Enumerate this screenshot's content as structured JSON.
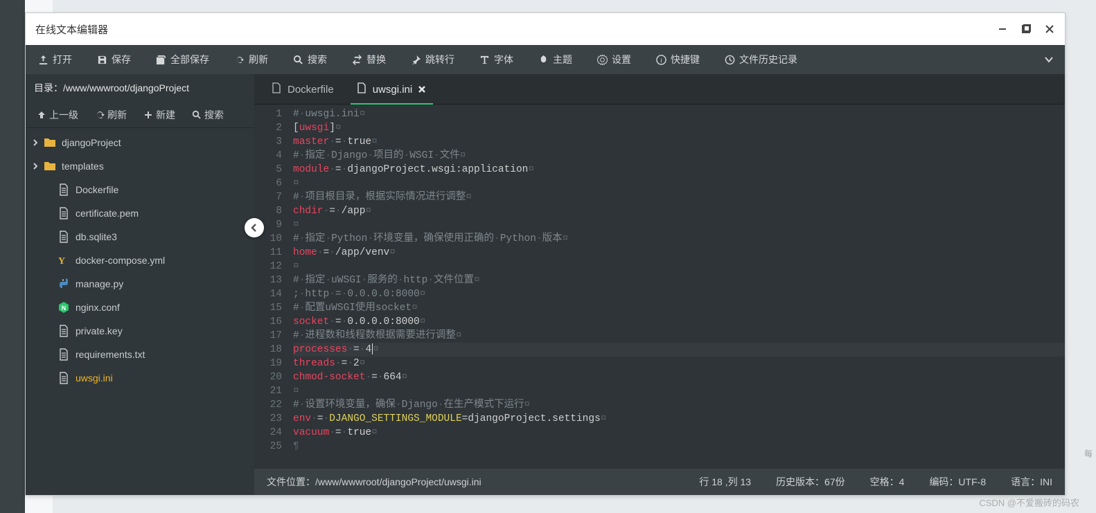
{
  "window_title": "在线文本编辑器",
  "toolbar": {
    "open": "打开",
    "save": "保存",
    "save_all": "全部保存",
    "refresh": "刷新",
    "search": "搜索",
    "replace": "替换",
    "goto": "跳转行",
    "font": "字体",
    "theme": "主题",
    "settings": "设置",
    "shortcut": "快捷键",
    "history": "文件历史记录"
  },
  "sidebar": {
    "path_label": "目录：",
    "path_value": "/www/wwwroot/djangoProject",
    "tools": {
      "up": "上一级",
      "refresh": "刷新",
      "new": "新建",
      "search": "搜索"
    },
    "items": [
      {
        "type": "folder",
        "label": "djangoProject"
      },
      {
        "type": "folder",
        "label": "templates"
      },
      {
        "type": "file",
        "label": "Dockerfile",
        "icon": "file"
      },
      {
        "type": "file",
        "label": "certificate.pem",
        "icon": "file"
      },
      {
        "type": "file",
        "label": "db.sqlite3",
        "icon": "file"
      },
      {
        "type": "file",
        "label": "docker-compose.yml",
        "icon": "yml"
      },
      {
        "type": "file",
        "label": "manage.py",
        "icon": "py"
      },
      {
        "type": "file",
        "label": "nginx.conf",
        "icon": "nginx"
      },
      {
        "type": "file",
        "label": "private.key",
        "icon": "file"
      },
      {
        "type": "file",
        "label": "requirements.txt",
        "icon": "file"
      },
      {
        "type": "file",
        "label": "uwsgi.ini",
        "icon": "file",
        "active": true
      }
    ]
  },
  "tabs": [
    {
      "label": "Dockerfile",
      "active": false
    },
    {
      "label": "uwsgi.ini",
      "active": true,
      "closable": true
    }
  ],
  "code": {
    "lines": [
      [
        {
          "t": "comment",
          "v": "#"
        },
        {
          "t": "invis",
          "v": "·"
        },
        {
          "t": "comment",
          "v": "uwsgi.ini"
        },
        {
          "t": "invis",
          "v": "¤"
        }
      ],
      [
        {
          "t": "punc",
          "v": "["
        },
        {
          "t": "key",
          "v": "uwsgi"
        },
        {
          "t": "punc",
          "v": "]"
        },
        {
          "t": "invis",
          "v": "¤"
        }
      ],
      [
        {
          "t": "key",
          "v": "master"
        },
        {
          "t": "invis",
          "v": "·"
        },
        {
          "t": "punc",
          "v": "="
        },
        {
          "t": "invis",
          "v": "·"
        },
        {
          "t": "const",
          "v": "true"
        },
        {
          "t": "invis",
          "v": "¤"
        }
      ],
      [
        {
          "t": "comment",
          "v": "#"
        },
        {
          "t": "invis",
          "v": "·"
        },
        {
          "t": "comment",
          "v": "指定"
        },
        {
          "t": "invis",
          "v": "·"
        },
        {
          "t": "comment",
          "v": "Django"
        },
        {
          "t": "invis",
          "v": "·"
        },
        {
          "t": "comment",
          "v": "项目的"
        },
        {
          "t": "invis",
          "v": "·"
        },
        {
          "t": "comment",
          "v": "WSGI"
        },
        {
          "t": "invis",
          "v": "·"
        },
        {
          "t": "comment",
          "v": "文件"
        },
        {
          "t": "invis",
          "v": "¤"
        }
      ],
      [
        {
          "t": "key",
          "v": "module"
        },
        {
          "t": "invis",
          "v": "·"
        },
        {
          "t": "punc",
          "v": "="
        },
        {
          "t": "invis",
          "v": "·"
        },
        {
          "t": "const",
          "v": "djangoProject.wsgi:application"
        },
        {
          "t": "invis",
          "v": "¤"
        }
      ],
      [
        {
          "t": "invis",
          "v": "¤"
        }
      ],
      [
        {
          "t": "comment",
          "v": "#"
        },
        {
          "t": "invis",
          "v": "·"
        },
        {
          "t": "comment",
          "v": "项目根目录，根据实际情况进行调整"
        },
        {
          "t": "invis",
          "v": "¤"
        }
      ],
      [
        {
          "t": "key",
          "v": "chdir"
        },
        {
          "t": "invis",
          "v": "·"
        },
        {
          "t": "punc",
          "v": "="
        },
        {
          "t": "invis",
          "v": "·"
        },
        {
          "t": "const",
          "v": "/app"
        },
        {
          "t": "invis",
          "v": "¤"
        }
      ],
      [
        {
          "t": "invis",
          "v": "¤"
        }
      ],
      [
        {
          "t": "comment",
          "v": "#"
        },
        {
          "t": "invis",
          "v": "·"
        },
        {
          "t": "comment",
          "v": "指定"
        },
        {
          "t": "invis",
          "v": "·"
        },
        {
          "t": "comment",
          "v": "Python"
        },
        {
          "t": "invis",
          "v": "·"
        },
        {
          "t": "comment",
          "v": "环境变量，确保使用正确的"
        },
        {
          "t": "invis",
          "v": "·"
        },
        {
          "t": "comment",
          "v": "Python"
        },
        {
          "t": "invis",
          "v": "·"
        },
        {
          "t": "comment",
          "v": "版本"
        },
        {
          "t": "invis",
          "v": "¤"
        }
      ],
      [
        {
          "t": "key",
          "v": "home"
        },
        {
          "t": "invis",
          "v": "·"
        },
        {
          "t": "punc",
          "v": "="
        },
        {
          "t": "invis",
          "v": "·"
        },
        {
          "t": "const",
          "v": "/app/venv"
        },
        {
          "t": "invis",
          "v": "¤"
        }
      ],
      [
        {
          "t": "invis",
          "v": "¤"
        }
      ],
      [
        {
          "t": "comment",
          "v": "#"
        },
        {
          "t": "invis",
          "v": "·"
        },
        {
          "t": "comment",
          "v": "指定"
        },
        {
          "t": "invis",
          "v": "·"
        },
        {
          "t": "comment",
          "v": "uWSGI"
        },
        {
          "t": "invis",
          "v": "·"
        },
        {
          "t": "comment",
          "v": "服务的"
        },
        {
          "t": "invis",
          "v": "·"
        },
        {
          "t": "comment",
          "v": "http"
        },
        {
          "t": "invis",
          "v": "·"
        },
        {
          "t": "comment",
          "v": "文件位置"
        },
        {
          "t": "invis",
          "v": "¤"
        }
      ],
      [
        {
          "t": "comment",
          "v": ";"
        },
        {
          "t": "invis",
          "v": "·"
        },
        {
          "t": "comment",
          "v": "http"
        },
        {
          "t": "invis",
          "v": "·"
        },
        {
          "t": "comment",
          "v": "="
        },
        {
          "t": "invis",
          "v": "·"
        },
        {
          "t": "comment",
          "v": "0.0.0.0:8000"
        },
        {
          "t": "invis",
          "v": "¤"
        }
      ],
      [
        {
          "t": "comment",
          "v": "#"
        },
        {
          "t": "invis",
          "v": "·"
        },
        {
          "t": "comment",
          "v": "配置uWSGI使用socket"
        },
        {
          "t": "invis",
          "v": "¤"
        }
      ],
      [
        {
          "t": "key",
          "v": "socket"
        },
        {
          "t": "invis",
          "v": "·"
        },
        {
          "t": "punc",
          "v": "="
        },
        {
          "t": "invis",
          "v": "·"
        },
        {
          "t": "const",
          "v": "0.0.0.0:8000"
        },
        {
          "t": "invis",
          "v": "¤"
        }
      ],
      [
        {
          "t": "comment",
          "v": "#"
        },
        {
          "t": "invis",
          "v": "·"
        },
        {
          "t": "comment",
          "v": "进程数和线程数根据需要进行调整"
        },
        {
          "t": "invis",
          "v": "¤"
        }
      ],
      [
        {
          "t": "key",
          "v": "processes"
        },
        {
          "t": "invis",
          "v": "·"
        },
        {
          "t": "punc",
          "v": "="
        },
        {
          "t": "invis",
          "v": "·"
        },
        {
          "t": "const",
          "v": "4"
        },
        {
          "t": "cursor",
          "v": ""
        },
        {
          "t": "invis",
          "v": "¤"
        }
      ],
      [
        {
          "t": "key",
          "v": "threads"
        },
        {
          "t": "invis",
          "v": "·"
        },
        {
          "t": "punc",
          "v": "="
        },
        {
          "t": "invis",
          "v": "·"
        },
        {
          "t": "const",
          "v": "2"
        },
        {
          "t": "invis",
          "v": "¤"
        }
      ],
      [
        {
          "t": "key",
          "v": "chmod-socket"
        },
        {
          "t": "invis",
          "v": "·"
        },
        {
          "t": "punc",
          "v": "="
        },
        {
          "t": "invis",
          "v": "·"
        },
        {
          "t": "const",
          "v": "664"
        },
        {
          "t": "invis",
          "v": "¤"
        }
      ],
      [
        {
          "t": "invis",
          "v": "¤"
        }
      ],
      [
        {
          "t": "comment",
          "v": "#"
        },
        {
          "t": "invis",
          "v": "·"
        },
        {
          "t": "comment",
          "v": "设置环境变量，确保"
        },
        {
          "t": "invis",
          "v": "·"
        },
        {
          "t": "comment",
          "v": "Django"
        },
        {
          "t": "invis",
          "v": "·"
        },
        {
          "t": "comment",
          "v": "在生产模式下运行"
        },
        {
          "t": "invis",
          "v": "¤"
        }
      ],
      [
        {
          "t": "key",
          "v": "env"
        },
        {
          "t": "invis",
          "v": "·"
        },
        {
          "t": "punc",
          "v": "="
        },
        {
          "t": "invis",
          "v": "·"
        },
        {
          "t": "str",
          "v": "DJANGO_SETTINGS_MODULE"
        },
        {
          "t": "const",
          "v": "=djangoProject.settings"
        },
        {
          "t": "invis",
          "v": "¤"
        }
      ],
      [
        {
          "t": "key",
          "v": "vacuum"
        },
        {
          "t": "invis",
          "v": "·"
        },
        {
          "t": "punc",
          "v": "="
        },
        {
          "t": "invis",
          "v": "·"
        },
        {
          "t": "const",
          "v": "true"
        },
        {
          "t": "invis",
          "v": "¤"
        }
      ],
      [
        {
          "t": "invis",
          "v": "¶"
        }
      ]
    ],
    "highlight_line": 18
  },
  "status": {
    "file_label": "文件位置：",
    "file_path": "/www/wwwroot/djangoProject/uwsgi.ini",
    "pos": "行 18 ,列 13",
    "history": "历史版本：67份",
    "spaces": "空格：4",
    "encoding": "编码：UTF-8",
    "lang": "语言：INI"
  },
  "watermark": "CSDN @不爱搬砖的码农",
  "right_edge": "每"
}
